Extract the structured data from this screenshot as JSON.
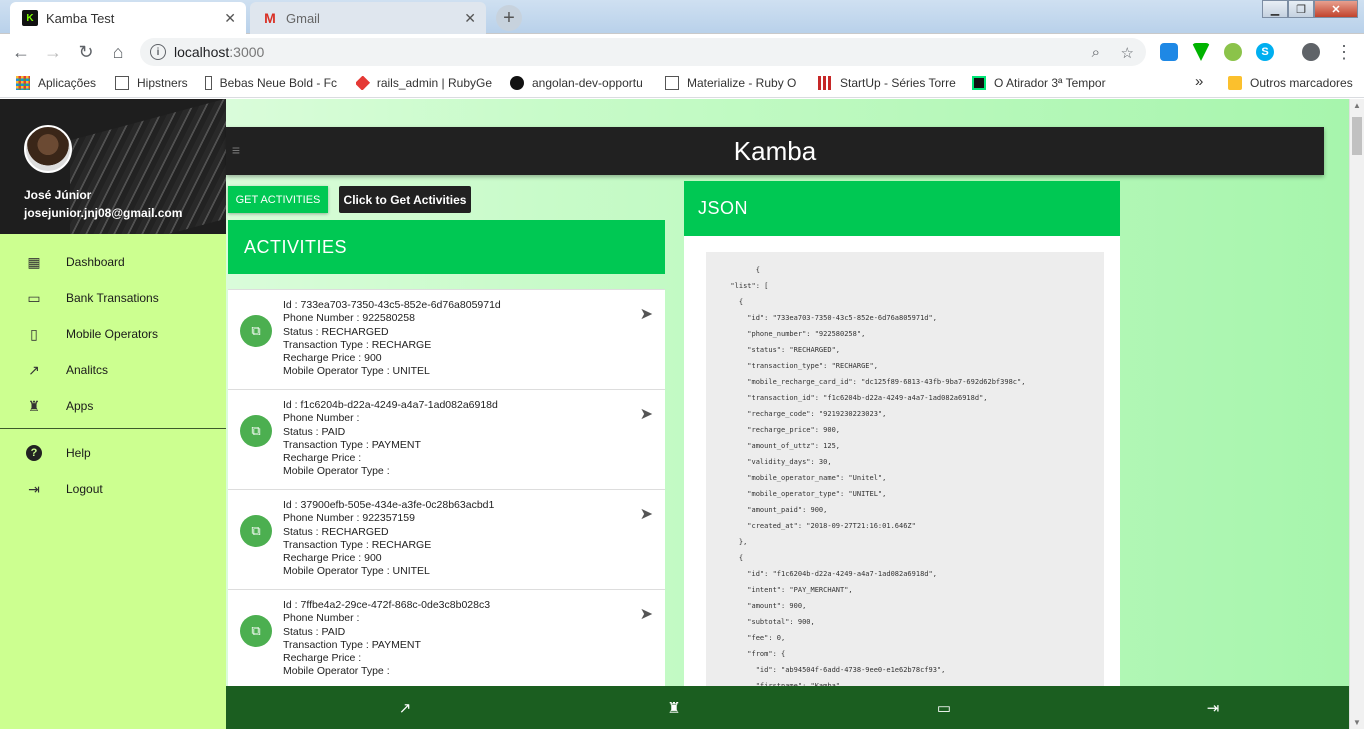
{
  "browser": {
    "tabs": [
      {
        "title": "Kamba Test",
        "active": true
      },
      {
        "title": "Gmail",
        "active": false
      }
    ],
    "url_host": "localhost",
    "url_port": ":3000",
    "bookmarks": [
      {
        "label": "Aplicações",
        "icon": "apps-grid-icon"
      },
      {
        "label": "Hipstners",
        "icon": "page-icon"
      },
      {
        "label": "Bebas Neue Bold - Fc",
        "icon": "page-icon"
      },
      {
        "label": "rails_admin | RubyGe",
        "icon": "ruby-icon"
      },
      {
        "label": "angolan-dev-opportu",
        "icon": "github-icon"
      },
      {
        "label": "Materialize - Ruby O",
        "icon": "page-icon"
      },
      {
        "label": "StartUp - Séries Torre",
        "icon": "popcorn-icon"
      },
      {
        "label": "O Atirador 3ª Tempor",
        "icon": "s-icon"
      }
    ],
    "bookmarks_more": "»",
    "other_bookmarks": "Outros marcadores"
  },
  "sidebar": {
    "user_name": "José Júnior",
    "user_email": "josejunior.jnj08@gmail.com",
    "menu": [
      {
        "label": "Dashboard",
        "icon": "dashboard-icon"
      },
      {
        "label": "Bank Transations",
        "icon": "credit-card-icon"
      },
      {
        "label": "Mobile Operators",
        "icon": "phone-operator-icon"
      },
      {
        "label": "Analitcs",
        "icon": "trending-up-icon"
      },
      {
        "label": "Apps",
        "icon": "android-icon"
      }
    ],
    "menu2": [
      {
        "label": "Help",
        "icon": "help-icon"
      },
      {
        "label": "Logout",
        "icon": "logout-icon"
      }
    ]
  },
  "header": {
    "title": "Kamba"
  },
  "actions": {
    "get_button": "GET ACTIVITIES",
    "tooltip": "Click to Get Activities"
  },
  "activities": {
    "title": "ACTIVITIES",
    "items": [
      {
        "id": "Id : 733ea703-7350-43c5-852e-6d76a805971d",
        "phone": "Phone Number : 922580258",
        "status": "Status : RECHARGED",
        "type": "Transaction Type : RECHARGE",
        "price": "Recharge Price : 900",
        "operator": "Mobile Operator Type : UNITEL"
      },
      {
        "id": "Id : f1c6204b-d22a-4249-a4a7-1ad082a6918d",
        "phone": "Phone Number :",
        "status": "Status : PAID",
        "type": "Transaction Type : PAYMENT",
        "price": "Recharge Price :",
        "operator": "Mobile Operator Type :"
      },
      {
        "id": "Id : 37900efb-505e-434e-a3fe-0c28b63acbd1",
        "phone": "Phone Number : 922357159",
        "status": "Status : RECHARGED",
        "type": "Transaction Type : RECHARGE",
        "price": "Recharge Price : 900",
        "operator": "Mobile Operator Type : UNITEL"
      },
      {
        "id": "Id : 7ffbe4a2-29ce-472f-868c-0de3c8b028c3",
        "phone": "Phone Number :",
        "status": "Status : PAID",
        "type": "Transaction Type : PAYMENT",
        "price": "Recharge Price :",
        "operator": "Mobile Operator Type :"
      }
    ]
  },
  "json_panel": {
    "title": "JSON",
    "content": "        {\n  \"list\": [\n    {\n      \"id\": \"733ea703-7350-43c5-852e-6d76a805971d\",\n      \"phone_number\": \"922580258\",\n      \"status\": \"RECHARGED\",\n      \"transaction_type\": \"RECHARGE\",\n      \"mobile_recharge_card_id\": \"dc125f89-6813-43fb-9ba7-692d62bf398c\",\n      \"transaction_id\": \"f1c6204b-d22a-4249-a4a7-1ad082a6918d\",\n      \"recharge_code\": \"9219230223023\",\n      \"recharge_price\": 900,\n      \"amount_of_uttz\": 125,\n      \"validity_days\": 30,\n      \"mobile_operator_name\": \"Unitel\",\n      \"mobile_operator_type\": \"UNITEL\",\n      \"amount_paid\": 900,\n      \"created_at\": \"2018-09-27T21:16:01.646Z\"\n    },\n    {\n      \"id\": \"f1c6204b-d22a-4249-a4a7-1ad082a6918d\",\n      \"intent\": \"PAY_MERCHANT\",\n      \"amount\": 900,\n      \"subtotal\": 900,\n      \"fee\": 0,\n      \"from\": {\n        \"id\": \"ab94504f-6add-4738-9ee0-e1e62b78cf93\",\n        \"firstname\": \"Kamba\","
  },
  "colors": {
    "accent": "#00c853",
    "sidebar_bg": "#ccff90",
    "topbar_bg": "#212121",
    "bottomnav_bg": "#1b5e20"
  }
}
